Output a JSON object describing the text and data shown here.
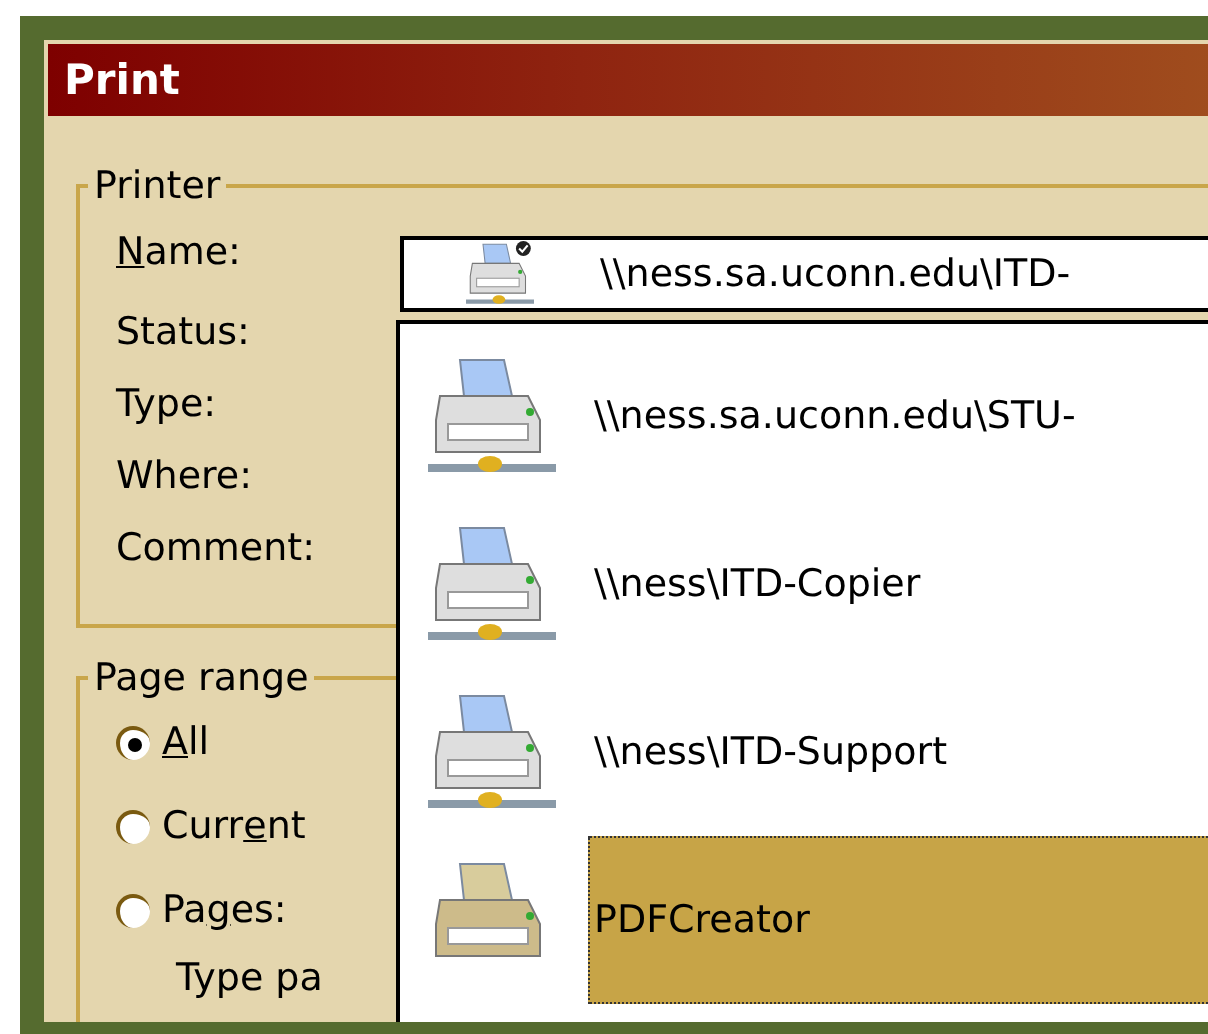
{
  "window": {
    "title": "Print"
  },
  "printer": {
    "legend": "Printer",
    "name_label": {
      "key": "N",
      "after": "ame:"
    },
    "name_value": {
      "text": "\\\\ness.sa.uconn.edu\\ITD-",
      "kind": "network",
      "default": true
    },
    "fields": [
      "Status:",
      "Type:",
      "Where:",
      "Comment:"
    ],
    "dropdown": [
      {
        "text": "\\\\ness.sa.uconn.edu\\STU-",
        "kind": "network",
        "selected": false
      },
      {
        "text": "\\\\ness\\ITD-Copier",
        "kind": "network",
        "selected": false
      },
      {
        "text": "\\\\ness\\ITD-Support",
        "kind": "network",
        "selected": false
      },
      {
        "text": "PDFCreator",
        "kind": "local",
        "selected": true
      }
    ]
  },
  "page_range": {
    "legend": "Page range",
    "options": [
      {
        "label": {
          "key": "A",
          "after": "ll"
        },
        "selected": true
      },
      {
        "label": {
          "before": "Curr",
          "key": "e",
          "after": "nt"
        },
        "selected": false
      },
      {
        "label": {
          "before": "Pa",
          "key": "g",
          "after": "es:"
        },
        "selected": false
      }
    ],
    "hint": "Type pa"
  }
}
